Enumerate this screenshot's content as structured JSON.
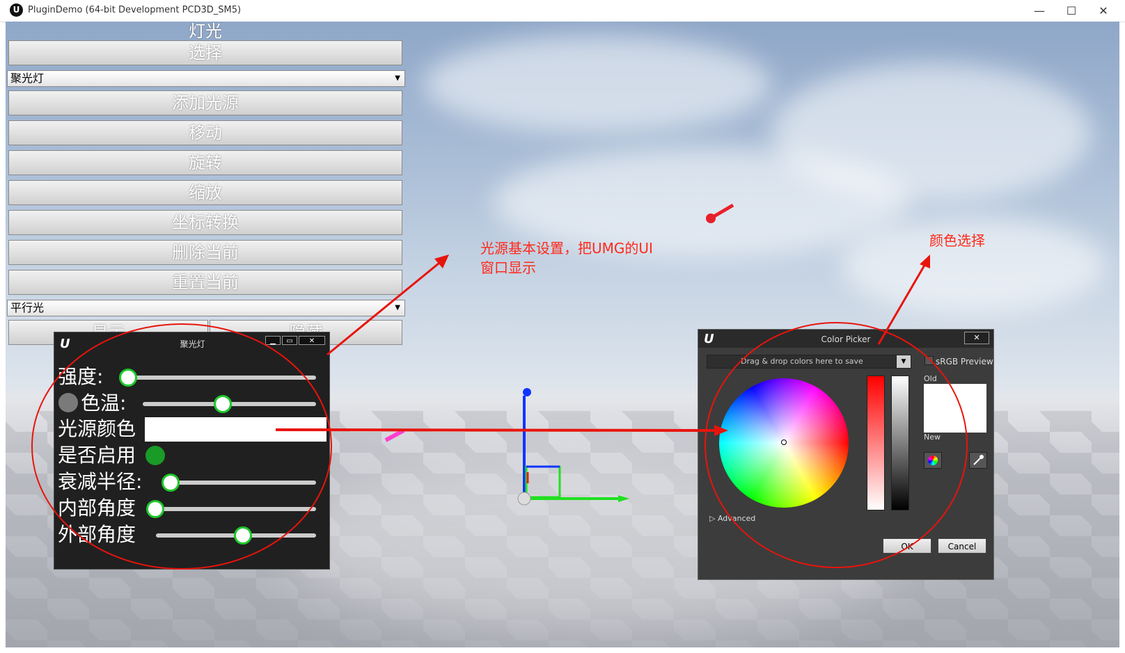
{
  "window": {
    "title": "PluginDemo (64-bit Development PCD3D_SM5)",
    "logo": "U",
    "min": "—",
    "max": "☐",
    "close": "✕"
  },
  "left_panel": {
    "title": "灯光",
    "select_button": "选择",
    "light_type_combo": "聚光灯",
    "buttons": [
      "添加光源",
      "移动",
      "旋转",
      "缩放",
      "坐标转换",
      "删除当前",
      "重置当前"
    ],
    "second_combo": "平行光",
    "show_button": "显示",
    "hide_button": "隐藏"
  },
  "light_window": {
    "logo": "U",
    "title": "聚光灯",
    "btn_min": "▁",
    "btn_max": "▭",
    "btn_close": "✕",
    "rows": {
      "intensity": "强度:",
      "color_temp": "色温:",
      "light_color": "光源颜色",
      "enabled": "是否启用",
      "attenuation": "衰减半径:",
      "inner_angle": "内部角度",
      "outer_angle": "外部角度"
    }
  },
  "color_picker": {
    "logo": "U",
    "title": "Color Picker",
    "close": "✕",
    "drop_zone": "Drag & drop colors here to save",
    "dropdown_arrow": "▼",
    "srgb_label": "sRGB Preview",
    "old_label": "Old",
    "new_label": "New",
    "advanced": "▷ Advanced",
    "ok": "OK",
    "cancel": "Cancel"
  },
  "annotations": {
    "umg_note_line1": "光源基本设置，把UMG的UI",
    "umg_note_line2": "窗口显示",
    "color_note": "颜色选择"
  },
  "colors": {
    "accent_red": "#ff2a1a",
    "slider_green": "#1ec82a"
  },
  "icons": [
    "unreal-logo-icon",
    "dropdown-arrow-icon",
    "color-wheel-icon",
    "eyedropper-icon"
  ]
}
